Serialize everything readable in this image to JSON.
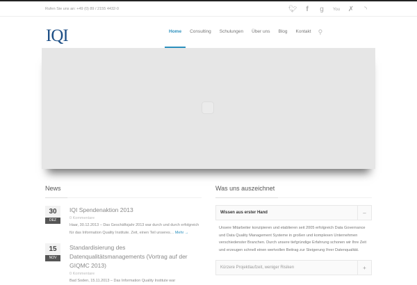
{
  "topbar": {
    "phone": "Rufen Sie uns an: +49 (0) 89 / 2155 4432-0",
    "social": [
      "twitter",
      "facebook",
      "google-plus",
      "youtube",
      "xing",
      "rss"
    ]
  },
  "logo": "IQI",
  "nav": [
    "Home",
    "Consulting",
    "Schulungen",
    "Über uns",
    "Blog",
    "Kontakt"
  ],
  "news": {
    "heading": "News",
    "posts": [
      {
        "day": "30",
        "month": "DEZ",
        "title": "IQI Spendenaktion 2013",
        "meta": "0 Kommentare",
        "excerpt": "Haar, 30.12.2013 – Das Geschäftsjahr 2013 war durch und durch erfolgreich für das Information Quality Institute. Zeit, einen Teil unseres…",
        "more": "Mehr →"
      },
      {
        "day": "15",
        "month": "NOV",
        "title": "Standardisierung des Datenqualitätsmanagements (Vortrag auf der GIQMC 2013)",
        "meta": "0 Kommentare",
        "excerpt": "Bad Soden, 15.11.2013 – Das Information Quality Institute war"
      }
    ]
  },
  "features": {
    "heading": "Was uns auszeichnet",
    "items": [
      {
        "title": "Wissen aus erster Hand",
        "toggle": "–",
        "text": "Unsere Mitarbeiter konzipieren und etablieren seit 2005 erfolgreich Data Governance und Data Quality Management Systeme in großen und komplexen Unternehmen verschiedenster Branchen. Durch unsere tiefgründige Erfahrung schonen wir Ihre Zeit und erzeugen schnell einen wertvollen Beitrag zur Steigerung Ihrer Datenqualität."
      },
      {
        "title": "Kürzere Projektlaufzeit, weniger Risiken",
        "toggle": "+"
      }
    ]
  }
}
